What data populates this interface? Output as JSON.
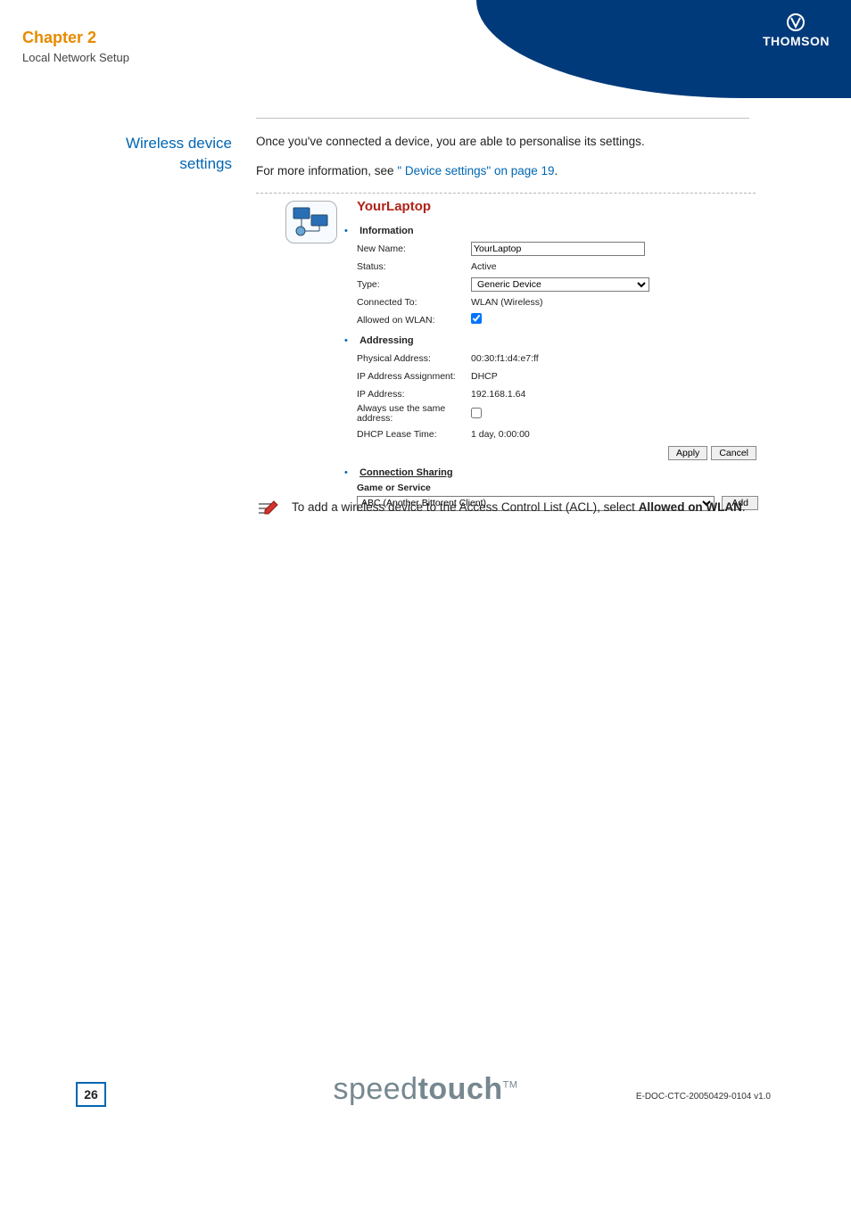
{
  "header": {
    "brand": "THOMSON",
    "chapter_title": "Chapter 2",
    "chapter_sub": "Local Network Setup"
  },
  "side": {
    "title_line1": "Wireless device",
    "title_line2": "settings"
  },
  "body": {
    "p1": "Once you've connected a device, you are able to personalise its settings.",
    "p2_a": "For more information, see ",
    "p2_link": "\" Device settings\" on page 19",
    "p2_b": "."
  },
  "shot": {
    "title": "YourLaptop",
    "sections": {
      "info": {
        "head": "Information",
        "rows": {
          "new_name_lbl": "New Name:",
          "new_name_val": "YourLaptop",
          "status_lbl": "Status:",
          "status_val": "Active",
          "type_lbl": "Type:",
          "type_val": "Generic Device",
          "connected_lbl": "Connected To:",
          "connected_val": "WLAN (Wireless)",
          "allowed_lbl": "Allowed on WLAN:",
          "allowed_checked": true
        }
      },
      "addr": {
        "head": "Addressing",
        "rows": {
          "phys_lbl": "Physical Address:",
          "phys_val": "00:30:f1:d4:e7:ff",
          "ipassign_lbl": "IP Address Assignment:",
          "ipassign_val": "DHCP",
          "ip_lbl": "IP Address:",
          "ip_val": "192.168.1.64",
          "same_lbl": "Always use the same address:",
          "same_checked": false,
          "lease_lbl": "DHCP Lease Time:",
          "lease_val": "1 day, 0:00:00"
        },
        "buttons": {
          "apply": "Apply",
          "cancel": "Cancel"
        }
      },
      "conn": {
        "head": "Connection Sharing",
        "sub": "Game or Service",
        "select_val": "ABC (Another Bittorent Client)",
        "add": "Add"
      }
    }
  },
  "note": {
    "text_a": "To add a wireless device to the Access Control List (ACL), select ",
    "bold1": "Allowed on WLAN",
    "text_b": "."
  },
  "footer": {
    "logo_thin": "speed",
    "logo_bold": "touch",
    "tm": "TM",
    "page": "26",
    "doc": "E-DOC-CTC-20050429-0104 v1.0"
  }
}
